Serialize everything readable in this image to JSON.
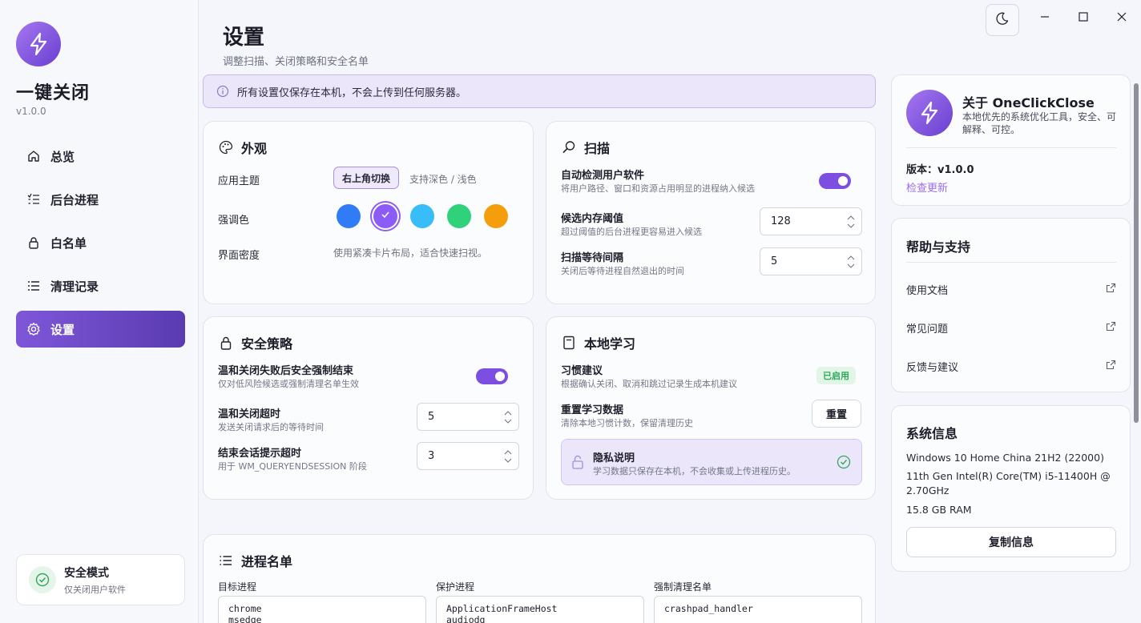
{
  "app": {
    "name": "一键关闭",
    "version": "v1.0.0"
  },
  "sidebar": {
    "items": [
      {
        "label": "总览",
        "icon": "home-icon"
      },
      {
        "label": "后台进程",
        "icon": "process-list-icon"
      },
      {
        "label": "白名单",
        "icon": "lock-icon"
      },
      {
        "label": "清理记录",
        "icon": "list-icon"
      },
      {
        "label": "设置",
        "icon": "gear-icon",
        "active": true
      }
    ],
    "safe_mode": {
      "title": "安全模式",
      "subtitle": "仅关闭用户软件"
    }
  },
  "header": {
    "title": "设置",
    "subtitle": "调整扫描、关闭策略和安全名单"
  },
  "notice": "所有设置仅保存在本机，不会上传到任何服务器。",
  "appearance": {
    "title": "外观",
    "theme_label": "应用主题",
    "theme_button": "右上角切换",
    "theme_hint": "支持深色 / 浅色",
    "accent_label": "强调色",
    "accent_colors": [
      "#2f7cf6",
      "#8b5cf6",
      "#38bdf8",
      "#2fd27a",
      "#f59e0b"
    ],
    "accent_selected": "#8b5cf6",
    "density_label": "界面密度",
    "density_value": "使用紧凑卡片布局，适合快速扫视。"
  },
  "scan": {
    "title": "扫描",
    "auto_detect": {
      "title": "自动检测用户软件",
      "desc": "将用户路径、窗口和资源占用明显的进程纳入候选",
      "enabled": true
    },
    "memory_threshold": {
      "title": "候选内存阈值",
      "desc": "超过阈值的后台进程更容易进入候选",
      "value": "128"
    },
    "wait_interval": {
      "title": "扫描等待间隔",
      "desc": "关闭后等待进程自然退出的时间",
      "value": "5"
    }
  },
  "security": {
    "title": "安全策略",
    "force_kill": {
      "title": "温和关闭失败后安全强制结束",
      "desc": "仅对低风险候选或强制清理名单生效",
      "enabled": true
    },
    "graceful_timeout": {
      "title": "温和关闭超时",
      "desc": "发送关闭请求后的等待时间",
      "value": "5"
    },
    "session_timeout": {
      "title": "结束会话提示超时",
      "desc": "用于 WM_QUERYENDSESSION 阶段",
      "value": "3"
    }
  },
  "learning": {
    "title": "本地学习",
    "habit": {
      "title": "习惯建议",
      "desc": "根据确认关闭、取消和跳过记录生成本机建议",
      "status": "已启用"
    },
    "reset": {
      "title": "重置学习数据",
      "desc": "清除本地习惯计数，保留清理历史",
      "button": "重置"
    },
    "privacy": {
      "title": "隐私说明",
      "desc": "学习数据只保存在本机，不会收集或上传进程历史。"
    }
  },
  "process_lists": {
    "title": "进程名单",
    "target": {
      "label": "目标进程",
      "content": "chrome\nmsedge"
    },
    "protected": {
      "label": "保护进程",
      "content": "ApplicationFrameHost\naudiodg"
    },
    "force": {
      "label": "强制清理名单",
      "content": "crashpad_handler"
    }
  },
  "about": {
    "title": "关于 OneClickClose",
    "desc": "本地优先的系统优化工具，安全、可解释、可控。",
    "version_label": "版本：v1.0.0",
    "check_update": "检查更新"
  },
  "help": {
    "title": "帮助与支持",
    "items": [
      "使用文档",
      "常见问题",
      "反馈与建议"
    ]
  },
  "sysinfo": {
    "title": "系统信息",
    "os": "Windows 10 Home China 21H2 (22000)",
    "cpu_line1": "11th Gen Intel(R) Core(TM) i5-11400H @",
    "cpu_line2": "2.70GHz",
    "ram": "15.8 GB RAM",
    "copy_button": "复制信息"
  },
  "colors": {
    "accent": "#7d4fe0",
    "success": "#2fa85a"
  }
}
